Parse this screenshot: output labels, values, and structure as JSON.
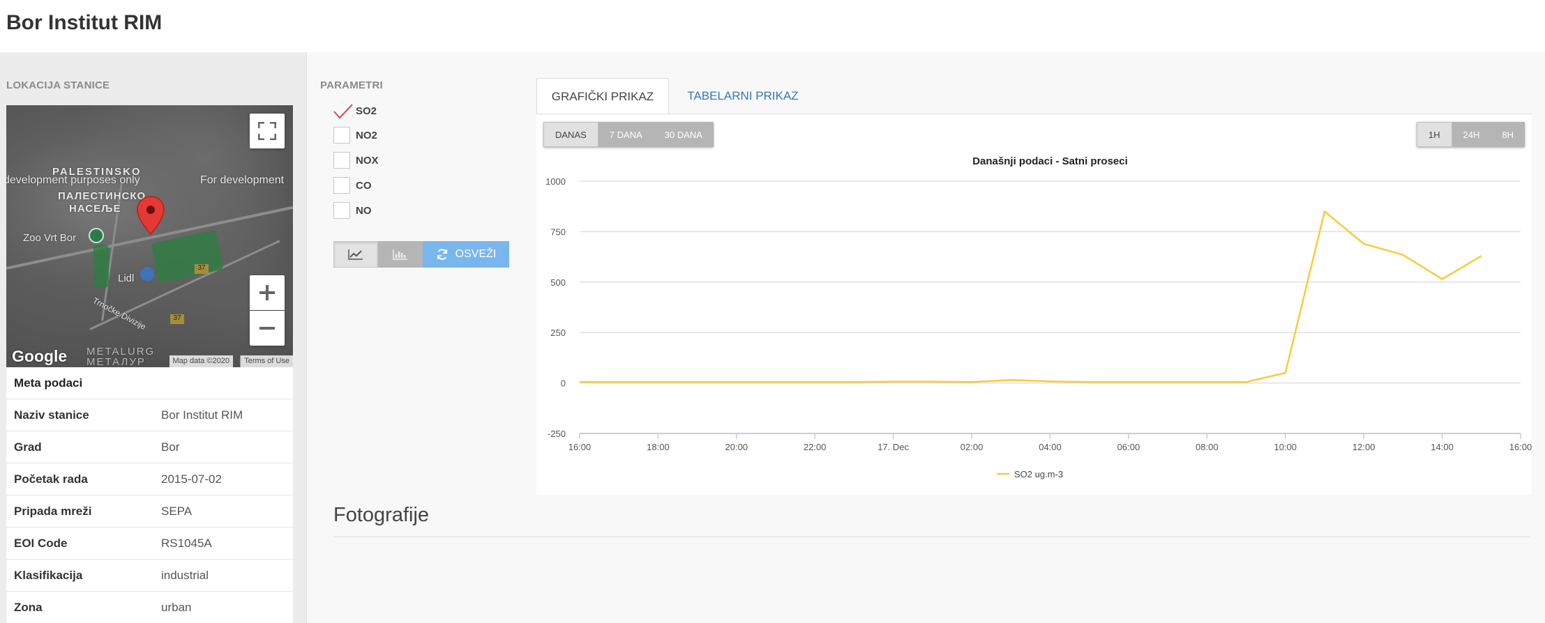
{
  "page": {
    "title": "Bor Institut RIM"
  },
  "location": {
    "label": "LOKACIJA STANICE",
    "map": {
      "labels": [
        "PALESTINSKO",
        "ПАЛЕСТИНСКО",
        "НАСЕЉЕ",
        "development purposes only",
        "For development",
        "Zoo Vrt Bor",
        "Lidl",
        "Trnočke Divizije",
        "METALURG",
        "МЕТАЛУР",
        "37",
        "37"
      ],
      "logo": "Google",
      "attribution": "Map data ©2020",
      "terms": "Terms of Use"
    }
  },
  "meta": {
    "heading": "Meta podaci",
    "rows": [
      {
        "key": "Naziv stanice",
        "value": "Bor Institut RIM"
      },
      {
        "key": "Grad",
        "value": "Bor"
      },
      {
        "key": "Početak rada",
        "value": "2015-07-02"
      },
      {
        "key": "Pripada mreži",
        "value": "SEPA"
      },
      {
        "key": "EOI Code",
        "value": "RS1045A"
      },
      {
        "key": "Klasifikacija",
        "value": "industrial"
      },
      {
        "key": "Zona",
        "value": "urban"
      }
    ]
  },
  "params": {
    "label": "PARAMETRI",
    "items": [
      {
        "name": "SO2",
        "checked": true
      },
      {
        "name": "NO2",
        "checked": false
      },
      {
        "name": "NOX",
        "checked": false
      },
      {
        "name": "CO",
        "checked": false
      },
      {
        "name": "NO",
        "checked": false
      }
    ],
    "refresh_label": "OSVEŽI"
  },
  "tabs": [
    {
      "label": "GRAFIČKI PRIKAZ",
      "active": true
    },
    {
      "label": "TABELARNI PRIKAZ",
      "active": false
    }
  ],
  "period_buttons": [
    {
      "label": "DANAS",
      "active": true
    },
    {
      "label": "7 DANA",
      "active": false
    },
    {
      "label": "30 DANA",
      "active": false
    }
  ],
  "interval_buttons": [
    {
      "label": "1H",
      "active": true
    },
    {
      "label": "24H",
      "active": false
    },
    {
      "label": "8H",
      "active": false
    }
  ],
  "colors": {
    "series": "#f7cb3a",
    "active_tab_text": "#444444",
    "link": "#337ab7",
    "refresh_button": "#7ab6ee"
  },
  "chart_data": {
    "type": "line",
    "title": "Današnji podaci - Satni proseci",
    "ylim": [
      -250,
      1000
    ],
    "yticks": [
      -250,
      0,
      250,
      500,
      750,
      1000
    ],
    "xticks": [
      "16:00",
      "18:00",
      "20:00",
      "22:00",
      "17. Dec",
      "02:00",
      "04:00",
      "06:00",
      "08:00",
      "10:00",
      "12:00",
      "14:00",
      "16:00"
    ],
    "x_start": "16:00",
    "x_hours_range": [
      0,
      24
    ],
    "grid": true,
    "legend": "bottom-center",
    "series": [
      {
        "name": "SO2 ug.m-3",
        "color": "#f7cb3a",
        "x_hours": [
          0,
          1,
          2,
          3,
          4,
          5,
          6,
          7,
          8,
          9,
          10,
          11,
          12,
          13,
          14,
          15,
          16,
          17,
          18,
          19,
          20,
          21,
          22,
          23
        ],
        "values": [
          5,
          5,
          5,
          5,
          5,
          5,
          5,
          5,
          7,
          7,
          5,
          15,
          8,
          5,
          5,
          5,
          5,
          5,
          50,
          850,
          690,
          635,
          515,
          630
        ]
      }
    ]
  }
}
